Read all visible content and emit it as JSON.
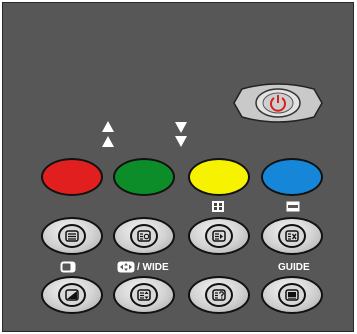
{
  "remote": {
    "labels": {
      "wide": "/ WIDE",
      "guide": "GUIDE"
    },
    "colors": {
      "panel": "#575757",
      "red": "#e11f1f",
      "green": "#0c8d2a",
      "yellow": "#f6f200",
      "blue": "#1687d8",
      "power_symbol": "#d92020"
    },
    "buttons": [
      {
        "name": "power-button",
        "icon": "power-icon"
      },
      {
        "name": "red-button",
        "icon": "page-up-icon"
      },
      {
        "name": "green-button",
        "icon": "page-down-icon"
      },
      {
        "name": "yellow-button",
        "icon": "picture-in-picture-icon"
      },
      {
        "name": "blue-button",
        "icon": "subtitle-bar-icon"
      },
      {
        "name": "teletext-button",
        "icon": "teletext-icon"
      },
      {
        "name": "teletext-clock-button",
        "icon": "teletext-clock-icon"
      },
      {
        "name": "teletext-index-button",
        "icon": "teletext-index-icon"
      },
      {
        "name": "teletext-cancel-button",
        "icon": "teletext-cancel-icon"
      },
      {
        "name": "teletext-mix-button",
        "icon": "teletext-mix-icon"
      },
      {
        "name": "teletext-size-button",
        "icon": "teletext-size-icon"
      },
      {
        "name": "teletext-reveal-button",
        "icon": "teletext-reveal-icon"
      },
      {
        "name": "guide-button",
        "icon": "guide-icon"
      }
    ]
  }
}
